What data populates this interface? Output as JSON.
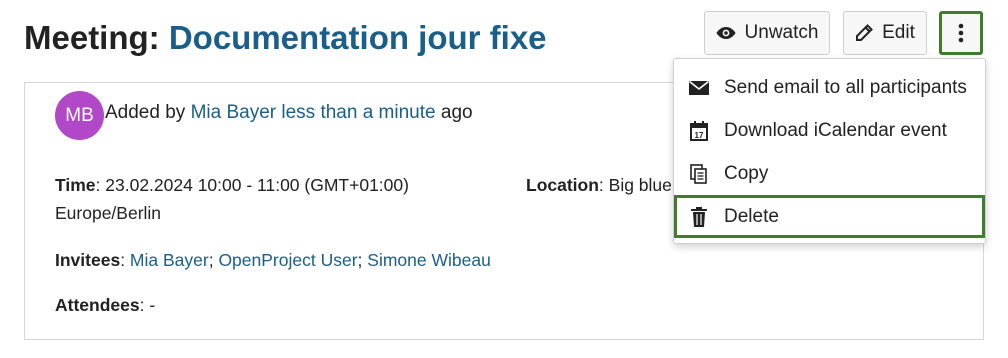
{
  "header": {
    "title_prefix": "Meeting:",
    "title_name": "Documentation jour fixe",
    "unwatch_label": "Unwatch",
    "edit_label": "Edit"
  },
  "meta": {
    "avatar_initials": "MB",
    "avatar_color": "#b048c8",
    "added_by_prefix": "Added by",
    "author": "Mia Bayer",
    "time_ago": "less than a minute",
    "ago_suffix": "ago"
  },
  "details": {
    "time_label": "Time",
    "time_value": ": 23.02.2024 10:00 - 11:00 (GMT+01:00)",
    "timezone": "Europe/Berlin",
    "location_label": "Location",
    "location_value": ": Big blue",
    "invitees_label": "Invitees",
    "invitees": [
      "Mia Bayer",
      "OpenProject User",
      "Simone Wibeau"
    ],
    "attendees_label": "Attendees",
    "attendees_value": ": -"
  },
  "menu": {
    "items": [
      {
        "label": "Send email to all participants",
        "icon": "envelope-icon"
      },
      {
        "label": "Download iCalendar event",
        "icon": "calendar-icon"
      },
      {
        "label": "Copy",
        "icon": "copy-icon"
      },
      {
        "label": "Delete",
        "icon": "trash-icon"
      }
    ]
  },
  "colors": {
    "link": "#1a5f8a",
    "highlight": "#3f7d2a"
  }
}
